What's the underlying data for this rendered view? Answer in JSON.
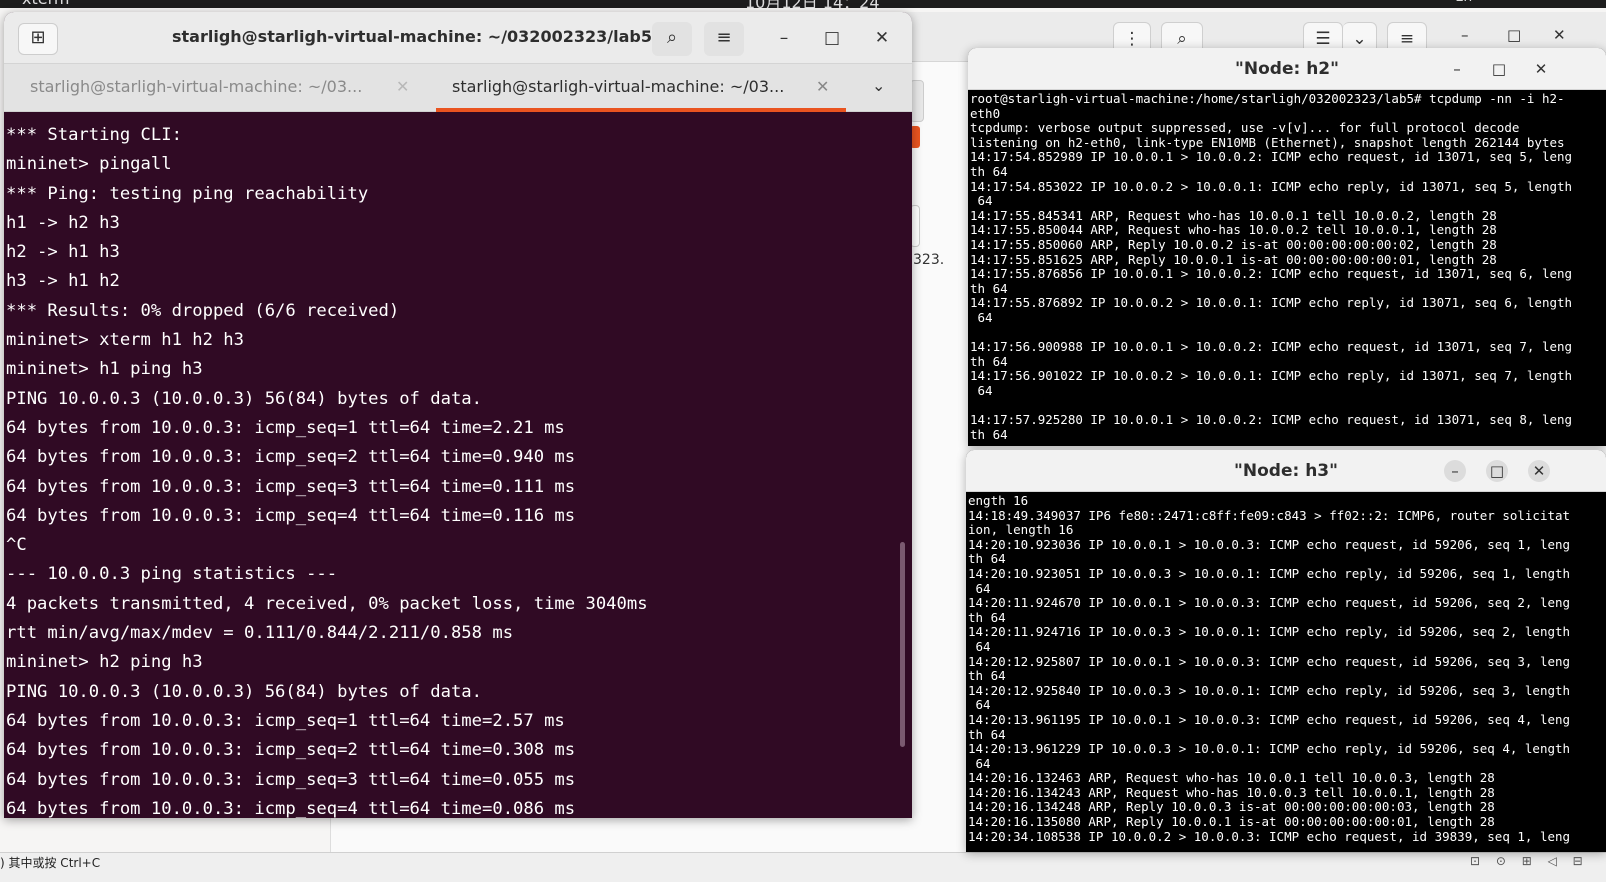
{
  "topbar": {
    "app": "xterm",
    "clock": "10月12日 14：24",
    "lang": "zh"
  },
  "background_window": {
    "file_name_fragment": "323.",
    "menu_dots": "⋮",
    "search": "⌕",
    "list_view": "☰",
    "chevron": "⌄",
    "hamburger": "≡",
    "minimize": "–",
    "maximize": "□",
    "close": "✕"
  },
  "bottombar": {
    "hint": ") 其中或按 Ctrl+C",
    "tray": "⊡ ⊙ ⊞ ◁ ⊟"
  },
  "terminal": {
    "title": "starligh@starligh-virtual-machine: ~/032002323/lab5",
    "new_tab_icon": "⊞",
    "search_icon": "⌕",
    "menu_icon": "≡",
    "minimize": "–",
    "maximize": "□",
    "close": "✕",
    "tabs": [
      {
        "label": "starligh@starligh-virtual-machine: ~/03...",
        "close": "✕"
      },
      {
        "label": "starligh@starligh-virtual-machine: ~/03...",
        "close": "✕"
      }
    ],
    "tabs_menu": "⌄",
    "lines": [
      "*** Starting CLI:",
      "mininet> pingall",
      "*** Ping: testing ping reachability",
      "h1 -> h2 h3",
      "h2 -> h1 h3",
      "h3 -> h1 h2",
      "*** Results: 0% dropped (6/6 received)",
      "mininet> xterm h1 h2 h3",
      "mininet> h1 ping h3",
      "PING 10.0.0.3 (10.0.0.3) 56(84) bytes of data.",
      "64 bytes from 10.0.0.3: icmp_seq=1 ttl=64 time=2.21 ms",
      "64 bytes from 10.0.0.3: icmp_seq=2 ttl=64 time=0.940 ms",
      "64 bytes from 10.0.0.3: icmp_seq=3 ttl=64 time=0.111 ms",
      "64 bytes from 10.0.0.3: icmp_seq=4 ttl=64 time=0.116 ms",
      "^C",
      "--- 10.0.0.3 ping statistics ---",
      "4 packets transmitted, 4 received, 0% packet loss, time 3040ms",
      "rtt min/avg/max/mdev = 0.111/0.844/2.211/0.858 ms",
      "mininet> h2 ping h3",
      "PING 10.0.0.3 (10.0.0.3) 56(84) bytes of data.",
      "64 bytes from 10.0.0.3: icmp_seq=1 ttl=64 time=2.57 ms",
      "64 bytes from 10.0.0.3: icmp_seq=2 ttl=64 time=0.308 ms",
      "64 bytes from 10.0.0.3: icmp_seq=3 ttl=64 time=0.055 ms",
      "64 bytes from 10.0.0.3: icmp_seq=4 ttl=64 time=0.086 ms"
    ]
  },
  "xterm_h2": {
    "title": "\"Node: h2\"",
    "minimize": "–",
    "maximize": "□",
    "close": "✕",
    "lines": [
      "root@starligh-virtual-machine:/home/starligh/032002323/lab5# tcpdump -nn -i h2-",
      "eth0",
      "tcpdump: verbose output suppressed, use -v[v]... for full protocol decode",
      "listening on h2-eth0, link-type EN10MB (Ethernet), snapshot length 262144 bytes",
      "14:17:54.852989 IP 10.0.0.1 > 10.0.0.2: ICMP echo request, id 13071, seq 5, leng",
      "th 64",
      "14:17:54.853022 IP 10.0.0.2 > 10.0.0.1: ICMP echo reply, id 13071, seq 5, length",
      " 64",
      "14:17:55.845341 ARP, Request who-has 10.0.0.1 tell 10.0.0.2, length 28",
      "14:17:55.850044 ARP, Request who-has 10.0.0.2 tell 10.0.0.1, length 28",
      "14:17:55.850060 ARP, Reply 10.0.0.2 is-at 00:00:00:00:00:02, length 28",
      "14:17:55.851625 ARP, Reply 10.0.0.1 is-at 00:00:00:00:00:01, length 28",
      "14:17:55.876856 IP 10.0.0.1 > 10.0.0.2: ICMP echo request, id 13071, seq 6, leng",
      "th 64",
      "14:17:55.876892 IP 10.0.0.2 > 10.0.0.1: ICMP echo reply, id 13071, seq 6, length",
      " 64",
      "",
      "14:17:56.900988 IP 10.0.0.1 > 10.0.0.2: ICMP echo request, id 13071, seq 7, leng",
      "th 64",
      "14:17:56.901022 IP 10.0.0.2 > 10.0.0.1: ICMP echo reply, id 13071, seq 7, length",
      " 64",
      "",
      "14:17:57.925280 IP 10.0.0.1 > 10.0.0.2: ICMP echo request, id 13071, seq 8, leng",
      "th 64"
    ]
  },
  "xterm_h3": {
    "title": "\"Node: h3\"",
    "minimize": "–",
    "maximize": "□",
    "close": "✕",
    "lines": [
      "ength 16",
      "14:18:49.349037 IP6 fe80::2471:c8ff:fe09:c843 > ff02::2: ICMP6, router solicitat",
      "ion, length 16",
      "14:20:10.923036 IP 10.0.0.1 > 10.0.0.3: ICMP echo request, id 59206, seq 1, leng",
      "th 64",
      "14:20:10.923051 IP 10.0.0.3 > 10.0.0.1: ICMP echo reply, id 59206, seq 1, length",
      " 64",
      "14:20:11.924670 IP 10.0.0.1 > 10.0.0.3: ICMP echo request, id 59206, seq 2, leng",
      "th 64",
      "14:20:11.924716 IP 10.0.0.3 > 10.0.0.1: ICMP echo reply, id 59206, seq 2, length",
      " 64",
      "14:20:12.925807 IP 10.0.0.1 > 10.0.0.3: ICMP echo request, id 59206, seq 3, leng",
      "th 64",
      "14:20:12.925840 IP 10.0.0.3 > 10.0.0.1: ICMP echo reply, id 59206, seq 3, length",
      " 64",
      "14:20:13.961195 IP 10.0.0.1 > 10.0.0.3: ICMP echo request, id 59206, seq 4, leng",
      "th 64",
      "14:20:13.961229 IP 10.0.0.3 > 10.0.0.1: ICMP echo reply, id 59206, seq 4, length",
      " 64",
      "14:20:16.132463 ARP, Request who-has 10.0.0.1 tell 10.0.0.3, length 28",
      "14:20:16.134243 ARP, Request who-has 10.0.0.3 tell 10.0.0.1, length 28",
      "14:20:16.134248 ARP, Reply 10.0.0.3 is-at 00:00:00:00:00:03, length 28",
      "14:20:16.135080 ARP, Reply 10.0.0.1 is-at 00:00:00:00:00:01, length 28",
      "14:20:34.108538 IP 10.0.0.2 > 10.0.0.3: ICMP echo request, id 39839, seq 1, leng"
    ]
  }
}
